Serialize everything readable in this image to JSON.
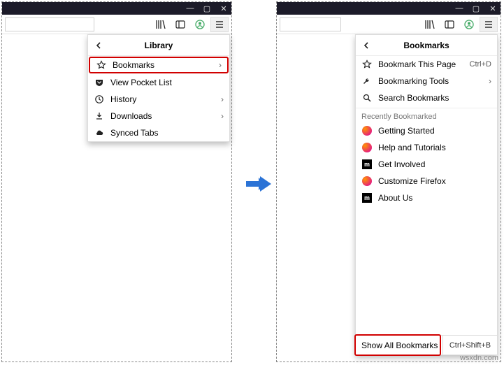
{
  "watermark": "wsxdn.com",
  "left": {
    "menu_title": "Library",
    "items": [
      {
        "label": "Bookmarks",
        "icon": "star",
        "chevron": true,
        "highlighted": true
      },
      {
        "label": "View Pocket List",
        "icon": "pocket",
        "chevron": false,
        "highlighted": false
      },
      {
        "label": "History",
        "icon": "clock",
        "chevron": true,
        "highlighted": false
      },
      {
        "label": "Downloads",
        "icon": "download",
        "chevron": true,
        "highlighted": false
      },
      {
        "label": "Synced Tabs",
        "icon": "cloud",
        "chevron": false,
        "highlighted": false
      }
    ]
  },
  "right": {
    "menu_title": "Bookmarks",
    "actions": [
      {
        "label": "Bookmark This Page",
        "icon": "star",
        "shortcut": "Ctrl+D"
      },
      {
        "label": "Bookmarking Tools",
        "icon": "wrench",
        "chevron": true
      },
      {
        "label": "Search Bookmarks",
        "icon": "search"
      }
    ],
    "section_label": "Recently Bookmarked",
    "recent": [
      {
        "label": "Getting Started",
        "favicon": "ff"
      },
      {
        "label": "Help and Tutorials",
        "favicon": "ff"
      },
      {
        "label": "Get Involved",
        "favicon": "mdn"
      },
      {
        "label": "Customize Firefox",
        "favicon": "ff"
      },
      {
        "label": "About Us",
        "favicon": "mdn"
      }
    ],
    "footer": {
      "label": "Show All Bookmarks",
      "shortcut": "Ctrl+Shift+B"
    }
  }
}
